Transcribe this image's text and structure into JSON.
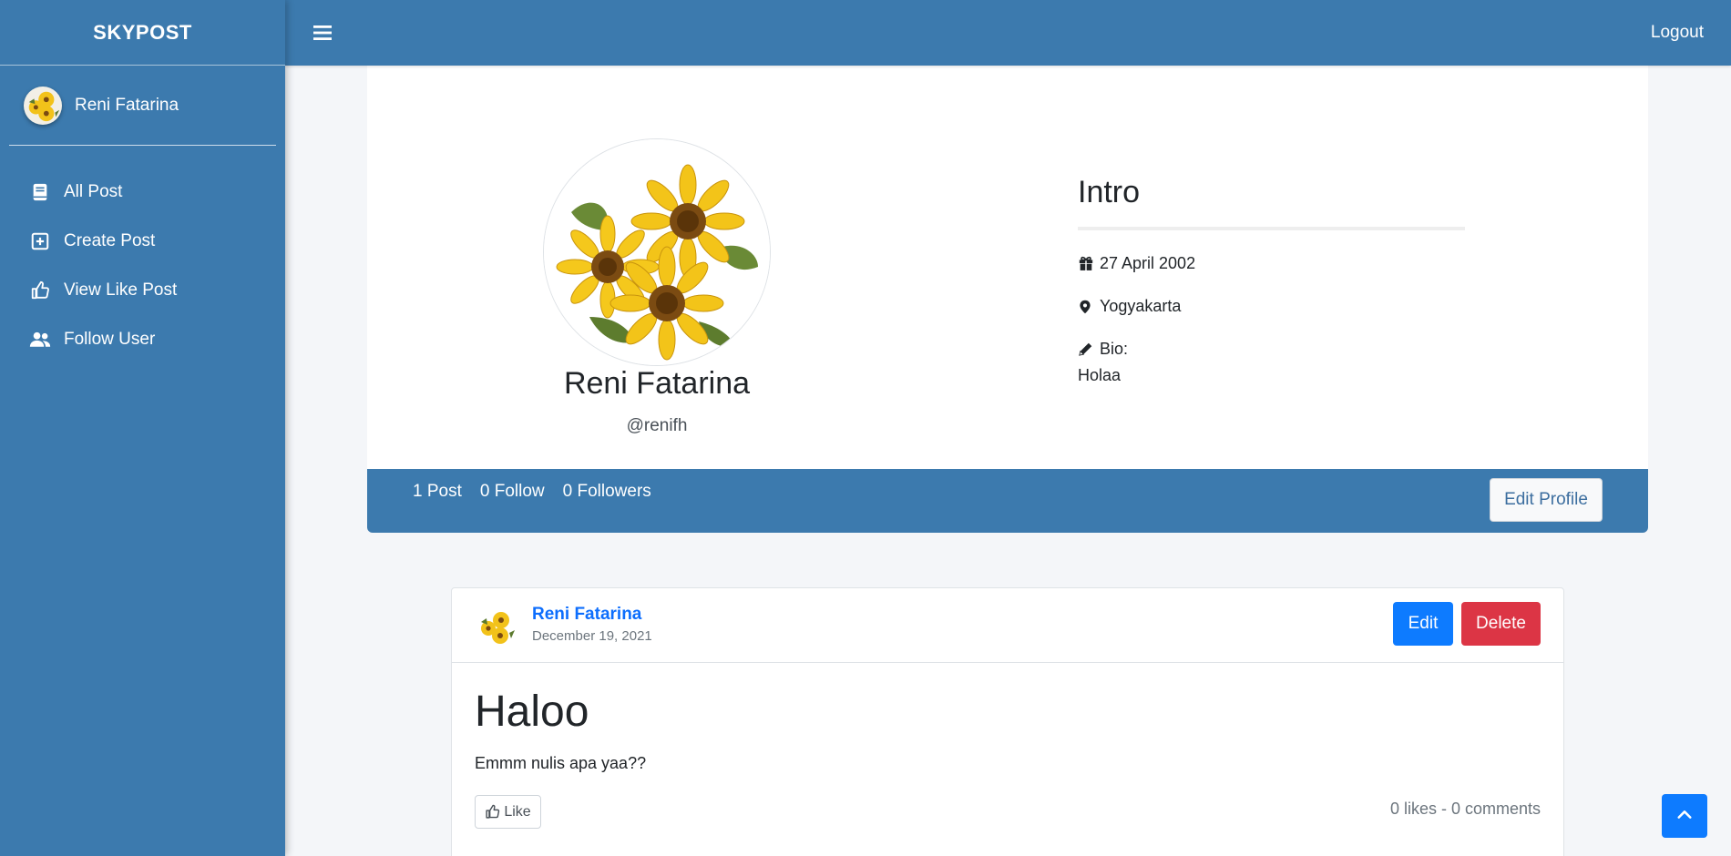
{
  "brand": {
    "name": "SKYPOST"
  },
  "user": {
    "name": "Reni Fatarina",
    "handle": "@renifh"
  },
  "sidebar": {
    "items": [
      {
        "label": "All Post",
        "icon": "book-icon"
      },
      {
        "label": "Create Post",
        "icon": "plus-square-icon"
      },
      {
        "label": "View Like Post",
        "icon": "thumbs-up-icon"
      },
      {
        "label": "Follow User",
        "icon": "users-icon"
      }
    ]
  },
  "topbar": {
    "logout_label": "Logout"
  },
  "profile": {
    "intro_title": "Intro",
    "birthday": "27 April 2002",
    "location": "Yogyakarta",
    "bio_label": "Bio:",
    "bio": "Holaa"
  },
  "stats": {
    "posts": "1 Post",
    "follow": "0 Follow",
    "followers": "0 Followers",
    "edit_profile_label": "Edit Profile"
  },
  "post": {
    "author": "Reni Fatarina",
    "date": "December 19, 2021",
    "edit_label": "Edit",
    "delete_label": "Delete",
    "title": "Haloo",
    "body": "Emmm nulis apa yaa??",
    "like_label": "Like",
    "counts": "0 likes - 0 comments"
  },
  "colors": {
    "primary": "#3c7aae",
    "button_blue": "#0d7bff",
    "button_red": "#dc3545",
    "link_blue": "#0d6efd"
  }
}
